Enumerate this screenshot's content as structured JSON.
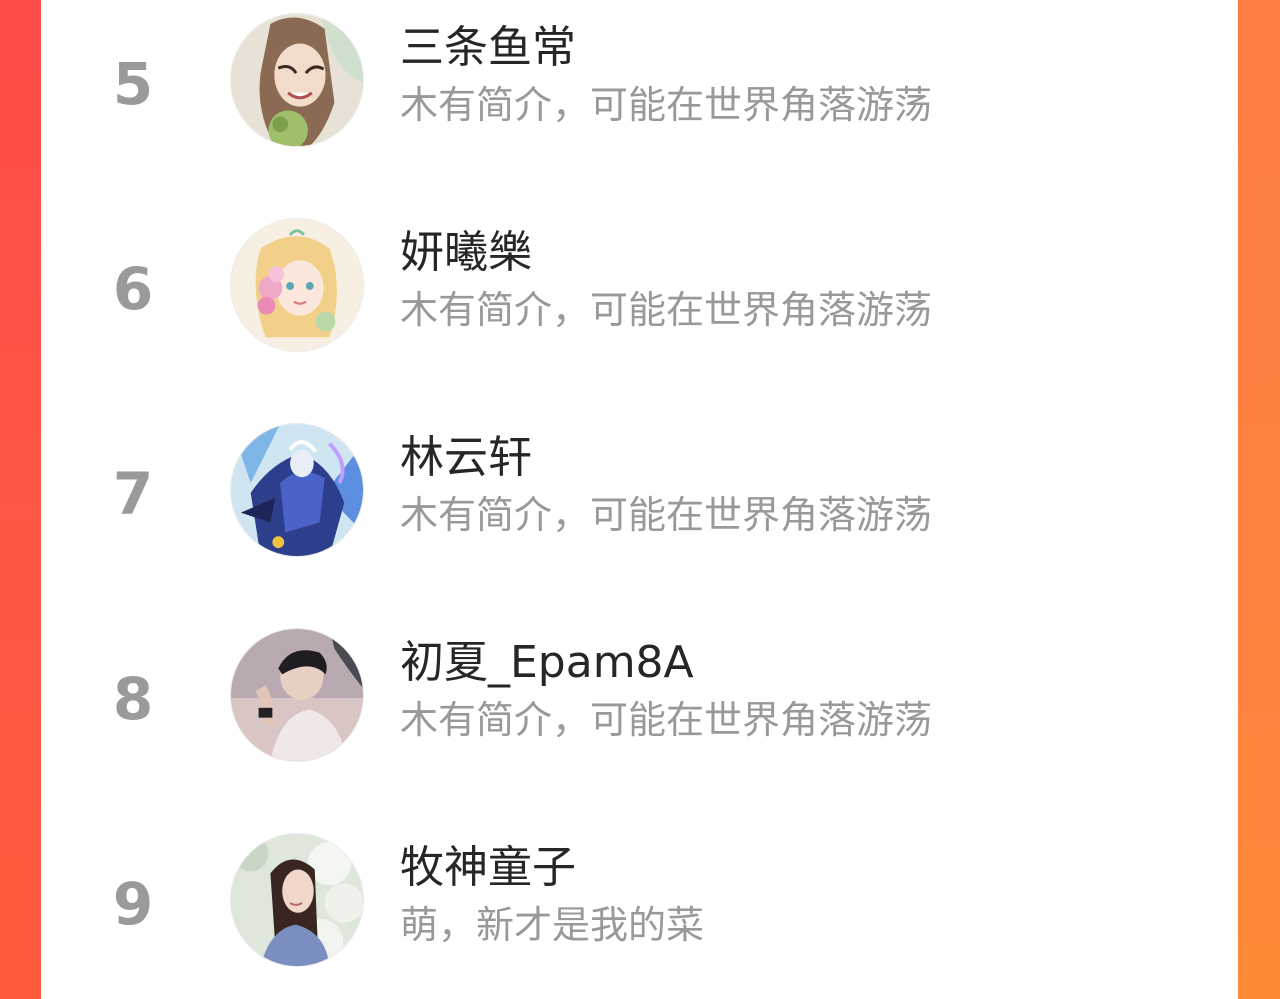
{
  "ranking": {
    "items": [
      {
        "rank": "5",
        "name": "三条鱼常",
        "bio": "木有简介，可能在世界角落游荡",
        "avatar_icon": "anime-girl-avatar-icon"
      },
      {
        "rank": "6",
        "name": "妍曦樂",
        "bio": "木有简介，可能在世界角落游荡",
        "avatar_icon": "flower-girl-avatar-icon"
      },
      {
        "rank": "7",
        "name": "林云轩",
        "bio": "木有简介，可能在世界角落游荡",
        "avatar_icon": "fantasy-warrior-avatar-icon"
      },
      {
        "rank": "8",
        "name": "初夏_Epam8A",
        "bio": "木有简介，可能在世界角落游荡",
        "avatar_icon": "man-portrait-avatar-icon"
      },
      {
        "rank": "9",
        "name": "牧神童子",
        "bio": "萌，新才是我的菜",
        "avatar_icon": "woman-portrait-avatar-icon"
      }
    ]
  },
  "theme": {
    "accent_left": "#ff4a3d",
    "accent_right": "#ff7b2b",
    "rank_color": "#9a9a9a",
    "name_color": "#262626",
    "bio_color": "#999999"
  }
}
